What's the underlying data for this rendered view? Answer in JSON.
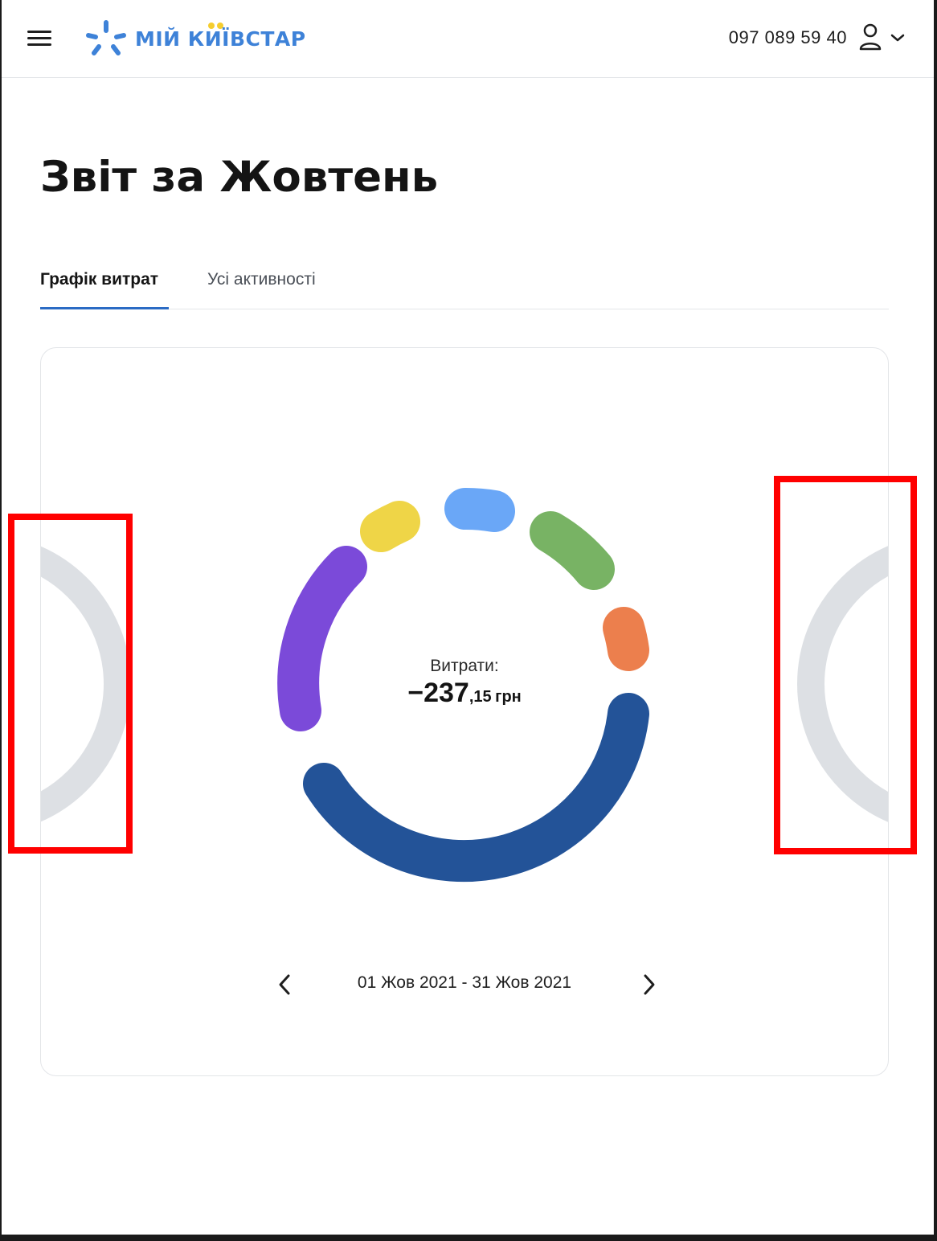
{
  "header": {
    "logo_text": "МІЙ КИЇВСТАР",
    "phone": "097 089 59 40"
  },
  "page": {
    "title": "Звіт за Жовтень"
  },
  "tabs": [
    {
      "label": "Графік витрат",
      "active": true
    },
    {
      "label": "Усі активності",
      "active": false
    }
  ],
  "report": {
    "spending_label": "Витрати:",
    "amount_integer": "−237",
    "amount_decimal": ",15",
    "currency": "грн",
    "date_range": "01 Жов 2021 - 31 Жов 2021"
  },
  "colors": {
    "accent": "#2b6bc4",
    "logo_blue": "#3e82d8",
    "logo_yellow": "#f5cd2e",
    "segment_dark_blue": "#235398",
    "segment_purple": "#7b4ad9",
    "segment_yellow": "#efd547",
    "segment_light_blue": "#6aa7f7",
    "segment_green": "#78b364",
    "segment_orange": "#ec7f4d",
    "neighbor_ring": "#dde0e4",
    "annotation_red": "#ff0000"
  }
}
